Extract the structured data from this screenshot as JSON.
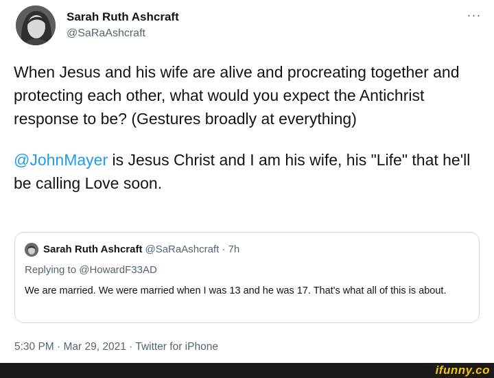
{
  "author": {
    "display_name": "Sarah Ruth Ashcraft",
    "handle": "@SaRaAshcraft"
  },
  "more_label": "···",
  "tweet": {
    "paragraph1": "When Jesus and his wife are alive and procreating together and protecting each other, what would you expect the Antichrist response to be? (Gestures broadly at everything)",
    "mention": "@JohnMayer",
    "paragraph2_rest": " is Jesus Christ and I am his wife, his \"Life\" that he'll be calling Love soon."
  },
  "quoted_tweet": {
    "display_name": "Sarah Ruth Ashcraft",
    "handle_time": "@SaRaAshcraft · 7h",
    "replying_to": "Replying to @HowardF33AD",
    "text": "We are married. We were married when I was 13 and he was 17. That's what all of this is about."
  },
  "meta": "5:30 PM · Mar 29, 2021 · Twitter for iPhone",
  "watermark": "ifunny.co"
}
